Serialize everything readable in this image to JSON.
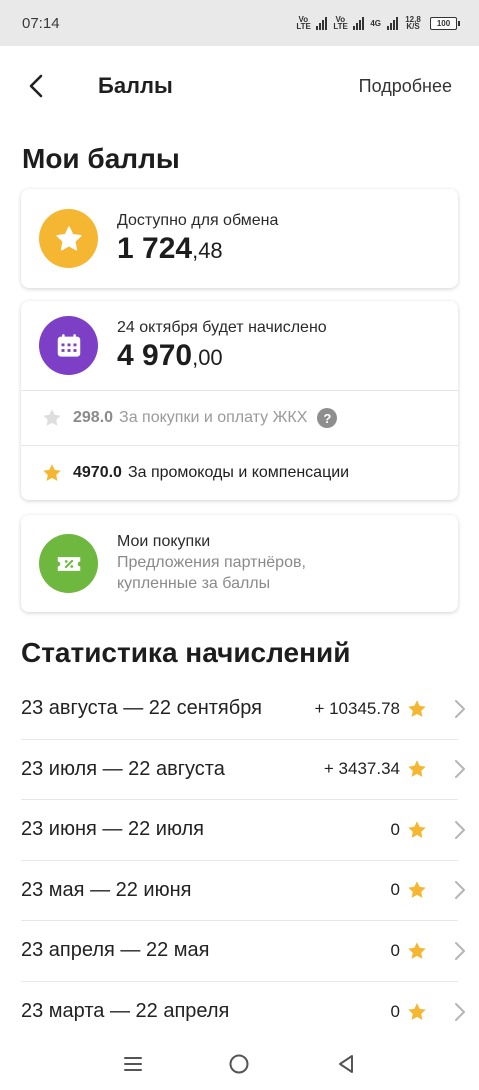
{
  "status_bar": {
    "time": "07:14",
    "net1": "Vo LTE",
    "net2": "Vo LTE",
    "net3": "4G",
    "speed": "12,8 K/S",
    "battery": "100"
  },
  "header": {
    "title": "Баллы",
    "more_label": "Подробнее"
  },
  "my_points": {
    "title": "Мои баллы",
    "available": {
      "label": "Доступно для обмена",
      "value_int": "1 724",
      "value_frac": ",48"
    },
    "pending": {
      "label": "24 октября будет начислено",
      "value_int": "4 970",
      "value_frac": ",00",
      "rows": [
        {
          "value": "298.0",
          "label": "За покупки и оплату ЖКХ",
          "help": "?"
        },
        {
          "value": "4970.0",
          "label": "За промокоды и компенсации"
        }
      ]
    },
    "purchases": {
      "title": "Мои покупки",
      "desc_line1": "Предложения партнёров,",
      "desc_line2": "купленные за баллы"
    }
  },
  "stats": {
    "title": "Статистика начислений",
    "rows": [
      {
        "period": "23 августа — 22 сентября",
        "value": "+ 10345.78"
      },
      {
        "period": "23 июля — 22 августа",
        "value": "+ 3437.34"
      },
      {
        "period": "23 июня — 22 июля",
        "value": "0"
      },
      {
        "period": "23 мая — 22 июня",
        "value": "0"
      },
      {
        "period": "23 апреля — 22 мая",
        "value": "0"
      },
      {
        "period": "23 марта — 22 апреля",
        "value": "0"
      }
    ]
  },
  "colors": {
    "accent_yellow": "#f5b731",
    "accent_purple": "#7c3fc6",
    "accent_green": "#6fb83f"
  }
}
